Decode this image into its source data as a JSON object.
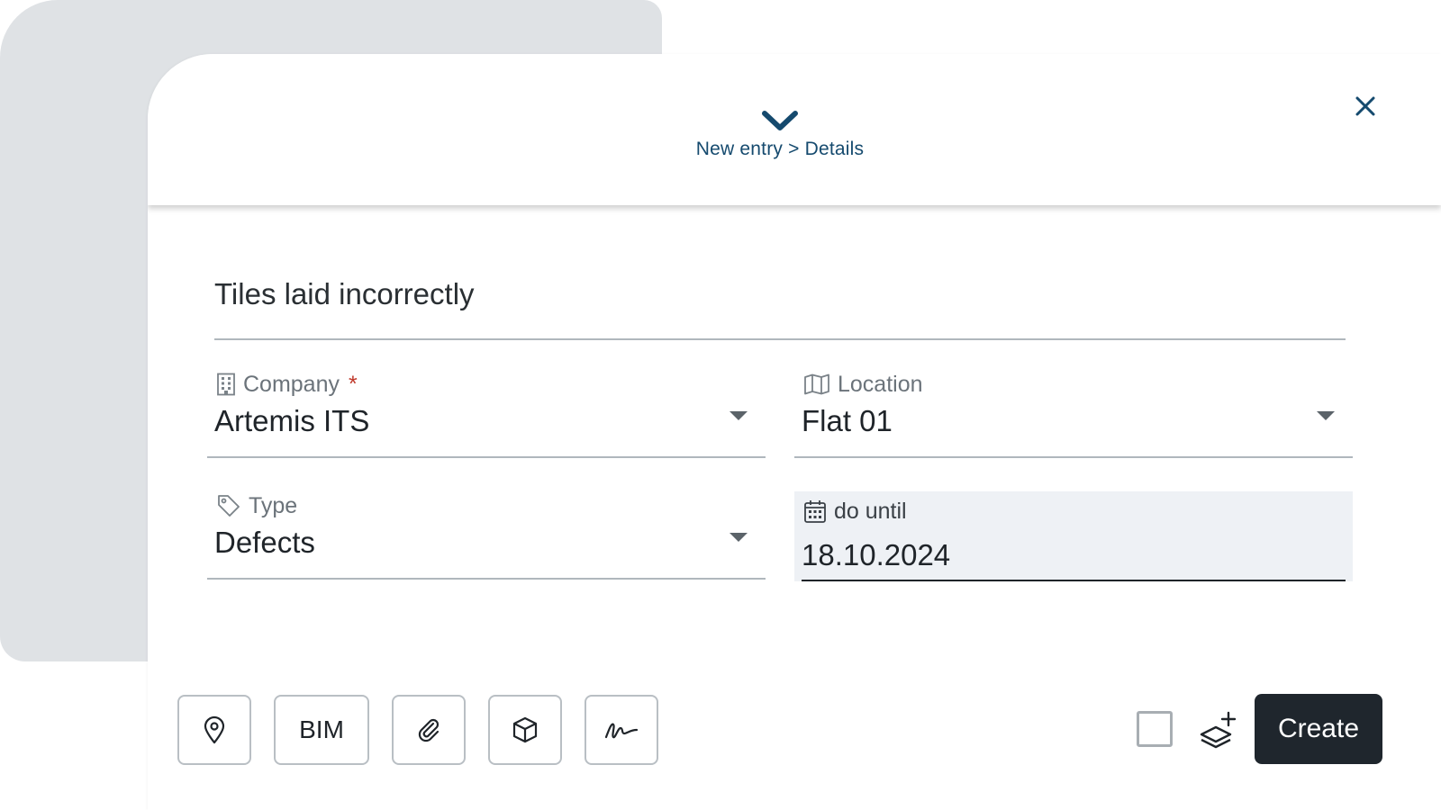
{
  "header": {
    "breadcrumb": "New entry > Details"
  },
  "title_field": {
    "value": "Tiles laid incorrectly"
  },
  "fields": {
    "company": {
      "label": "Company",
      "required_mark": "*",
      "value": "Artemis ITS",
      "icon": "building-icon"
    },
    "location": {
      "label": "Location",
      "value": "Flat 01",
      "icon": "map-icon"
    },
    "type": {
      "label": "Type",
      "value": "Defects",
      "icon": "tag-icon"
    },
    "due": {
      "label": "do until",
      "value": "18.10.2024",
      "icon": "calendar-icon"
    }
  },
  "toolbar": {
    "bim_label": "BIM",
    "create_label": "Create",
    "icons": [
      "map-pin-icon",
      "paperclip-icon",
      "cube-icon",
      "signature-icon",
      "layers-add-icon"
    ]
  },
  "colors": {
    "accent": "#154a6e",
    "primary_button": "#1f262d",
    "required": "#c0392b",
    "background_card": "#dfe2e5"
  }
}
